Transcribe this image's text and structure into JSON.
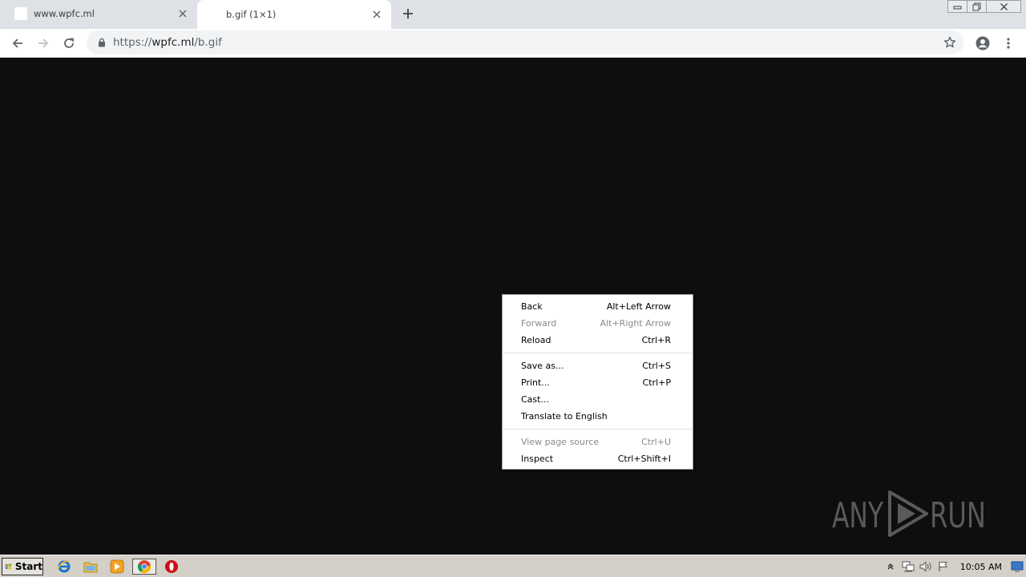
{
  "browser": {
    "tabs": [
      {
        "title": "www.wpfc.ml",
        "active": false
      },
      {
        "title": "b.gif (1×1)",
        "active": true
      }
    ],
    "url": {
      "scheme": "https://",
      "host": "wpfc.ml",
      "path": "/b.gif"
    }
  },
  "context_menu": {
    "groups": [
      [
        {
          "label": "Back",
          "shortcut": "Alt+Left Arrow",
          "enabled": true
        },
        {
          "label": "Forward",
          "shortcut": "Alt+Right Arrow",
          "enabled": false
        },
        {
          "label": "Reload",
          "shortcut": "Ctrl+R",
          "enabled": true
        }
      ],
      [
        {
          "label": "Save as...",
          "shortcut": "Ctrl+S",
          "enabled": true
        },
        {
          "label": "Print...",
          "shortcut": "Ctrl+P",
          "enabled": true
        },
        {
          "label": "Cast...",
          "shortcut": "",
          "enabled": true
        },
        {
          "label": "Translate to English",
          "shortcut": "",
          "enabled": true
        }
      ],
      [
        {
          "label": "View page source",
          "shortcut": "Ctrl+U",
          "enabled": false
        },
        {
          "label": "Inspect",
          "shortcut": "Ctrl+Shift+I",
          "enabled": true
        }
      ]
    ]
  },
  "watermark": {
    "text": "ANY RUN"
  },
  "taskbar": {
    "start_label": "Start",
    "clock": "10:05 AM",
    "pinned_icons": [
      "internet-explorer-icon",
      "file-explorer-icon",
      "media-player-icon",
      "chrome-icon",
      "opera-icon"
    ]
  },
  "colors": {
    "page_background": "#0e0e0e",
    "tabstrip": "#dee1e6",
    "omnibox": "#f1f3f4",
    "taskbar": "#d4d0c8"
  }
}
